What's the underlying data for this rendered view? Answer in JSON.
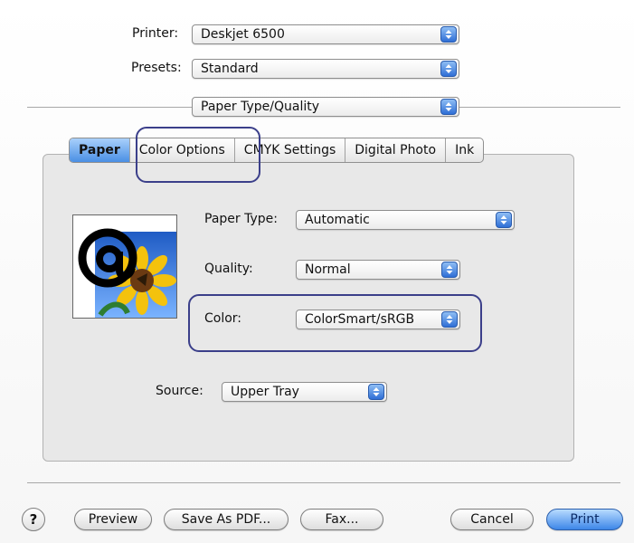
{
  "header": {
    "printer_label": "Printer:",
    "printer_value": "Deskjet 6500",
    "presets_label": "Presets:",
    "presets_value": "Standard",
    "panel_value": "Paper Type/Quality"
  },
  "tabs": [
    {
      "label": "Paper",
      "selected": true
    },
    {
      "label": "Color Options",
      "selected": false
    },
    {
      "label": "CMYK Settings",
      "selected": false
    },
    {
      "label": "Digital Photo",
      "selected": false
    },
    {
      "label": "Ink",
      "selected": false
    }
  ],
  "paper_panel": {
    "paper_type_label": "Paper Type:",
    "paper_type_value": "Automatic",
    "quality_label": "Quality:",
    "quality_value": "Normal",
    "color_label": "Color:",
    "color_value": "ColorSmart/sRGB",
    "source_label": "Source:",
    "source_value": "Upper Tray"
  },
  "footer": {
    "help_label": "?",
    "preview_label": "Preview",
    "save_pdf_label": "Save As PDF...",
    "fax_label": "Fax...",
    "cancel_label": "Cancel",
    "print_label": "Print"
  },
  "colors": {
    "accent_blue": "#4a8fe4",
    "highlight_outline": "#3b3f8a",
    "panel_background": "#e8e8e8"
  },
  "icons": [
    "popup-arrows-icon",
    "help-icon",
    "at-sign-sunflower-icon"
  ]
}
